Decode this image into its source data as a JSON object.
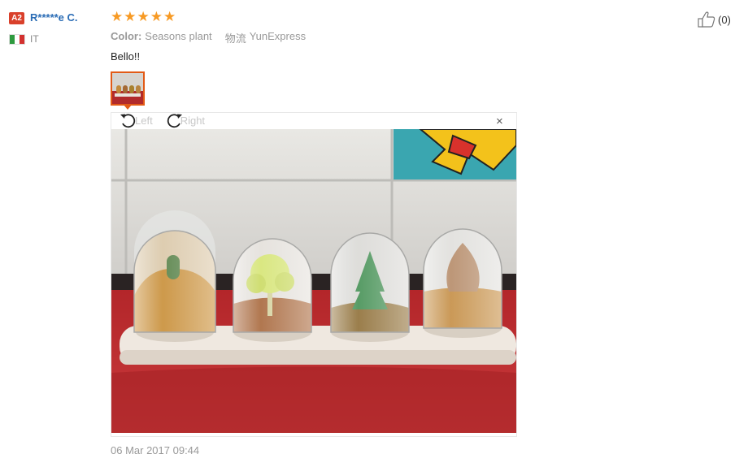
{
  "user": {
    "level": "A2",
    "name": "R*****e C.",
    "country": "IT",
    "flag_colors": [
      "#2e9a3f",
      "#ffffff",
      "#d3312f"
    ]
  },
  "review": {
    "rating": 5,
    "color_label": "Color:",
    "color_value": "Seasons plant",
    "logistics_label": "物流",
    "logistics_value": "YunExpress",
    "text": "Bello!!",
    "date": "06 Mar 2017 09:44"
  },
  "helpful": {
    "icon": "thumbs-up-icon",
    "count": "(0)"
  },
  "viewer": {
    "rotate_left_label": "Left",
    "rotate_right_label": "Right",
    "close_glyph": "×",
    "image_subject": "four-spice-jars-with-trees"
  },
  "colors": {
    "accent": "#e25a16",
    "star": "#f79a24",
    "username": "#2a6cb5",
    "badge": "#d9402b"
  }
}
